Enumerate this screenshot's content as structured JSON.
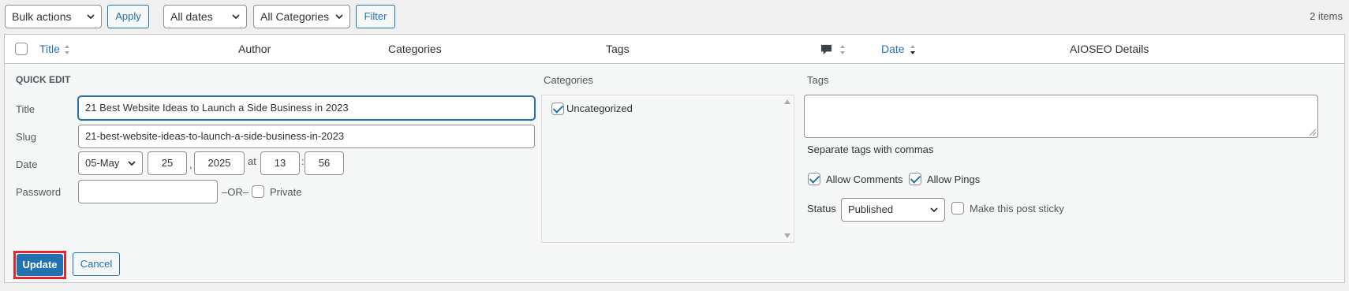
{
  "toolbar": {
    "bulk_actions": "Bulk actions",
    "apply": "Apply",
    "dates": "All dates",
    "categories": "All Categories",
    "filter": "Filter",
    "items_count": "2 items"
  },
  "table": {
    "columns": {
      "title": "Title",
      "author": "Author",
      "categories": "Categories",
      "tags": "Tags",
      "comments_icon": "comment-icon",
      "date": "Date",
      "aioseo": "AIOSEO Details"
    }
  },
  "quick_edit": {
    "heading": "QUICK EDIT",
    "title_label": "Title",
    "title_value": "21 Best Website Ideas to Launch a Side Business in 2023",
    "slug_label": "Slug",
    "slug_value": "21-best-website-ideas-to-launch-a-side-business-in-2023",
    "date_label": "Date",
    "month": "05-May",
    "day": "25",
    "comma": ",",
    "year": "2025",
    "at": "at",
    "hour": "13",
    "colon": ":",
    "minute": "56",
    "password_label": "Password",
    "password_value": "",
    "or": "–OR–",
    "private_label": "Private",
    "categories_label": "Categories",
    "categories_list": [
      {
        "label": "Uncategorized",
        "checked": true
      }
    ],
    "tags_label": "Tags",
    "tags_hint": "Separate tags with commas",
    "allow_comments": "Allow Comments",
    "allow_pings": "Allow Pings",
    "status_label": "Status",
    "status_value": "Published",
    "sticky_label": "Make this post sticky",
    "update": "Update",
    "cancel": "Cancel"
  },
  "colors": {
    "accent": "#2271b1",
    "highlight_border": "#e5262e",
    "panel_bg": "#f6f7f7",
    "page_bg": "#f0f0f1"
  }
}
